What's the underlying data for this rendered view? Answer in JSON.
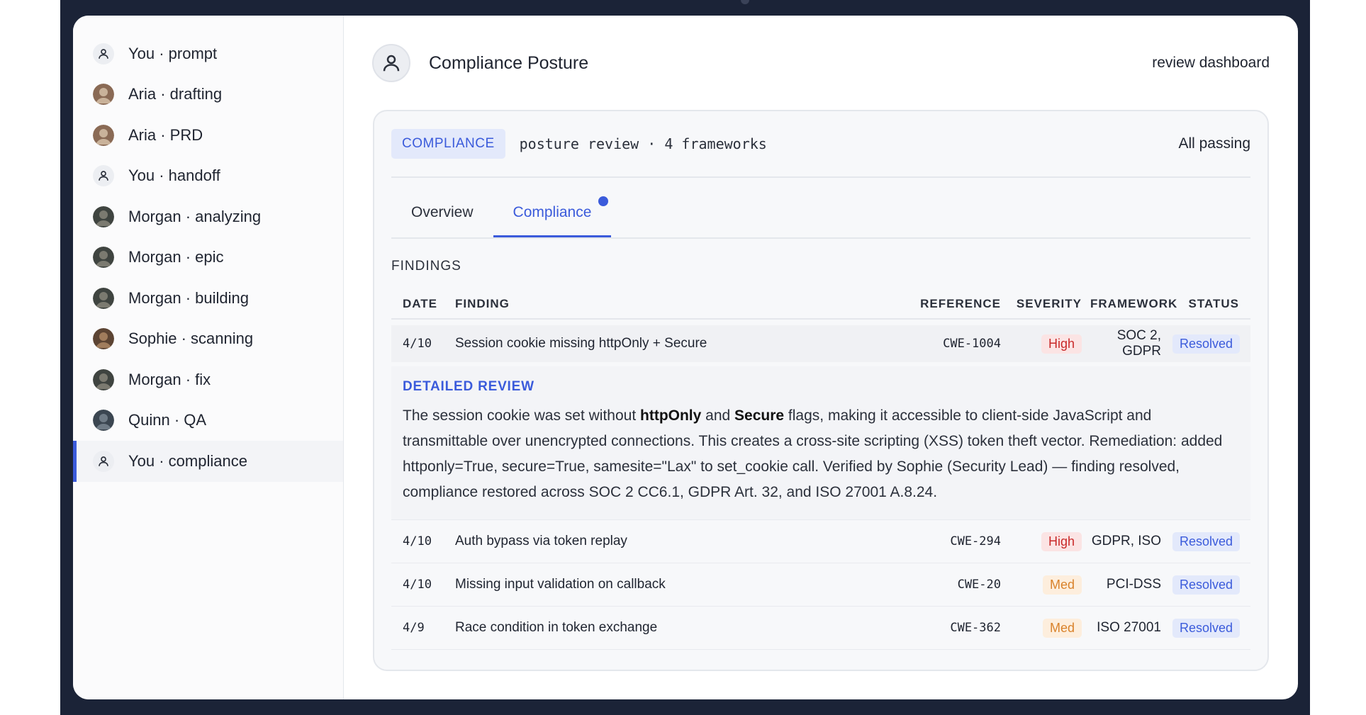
{
  "sidebar": {
    "items": [
      {
        "label": "You · prompt",
        "avatar": "user"
      },
      {
        "label": "Aria · drafting",
        "avatar": "photo-aria"
      },
      {
        "label": "Aria · PRD",
        "avatar": "photo-aria"
      },
      {
        "label": "You · handoff",
        "avatar": "user"
      },
      {
        "label": "Morgan · analyzing",
        "avatar": "photo-morgan"
      },
      {
        "label": "Morgan · epic",
        "avatar": "photo-morgan"
      },
      {
        "label": "Morgan · building",
        "avatar": "photo-morgan"
      },
      {
        "label": "Sophie · scanning",
        "avatar": "photo-sophie"
      },
      {
        "label": "Morgan · fix",
        "avatar": "photo-morgan"
      },
      {
        "label": "Quinn · QA",
        "avatar": "photo-quinn"
      },
      {
        "label": "You · compliance",
        "avatar": "user",
        "active": true
      }
    ]
  },
  "header": {
    "title": "Compliance Posture",
    "right": "review dashboard",
    "avatar_icon": "user-icon"
  },
  "card": {
    "pill": "COMPLIANCE",
    "subtitle": "posture review · 4 frameworks",
    "status": "All passing",
    "tabs": [
      {
        "label": "Overview"
      },
      {
        "label": "Compliance",
        "active": true,
        "notification": true
      }
    ],
    "section_label": "FINDINGS",
    "columns": {
      "date": "DATE",
      "finding": "FINDING",
      "reference": "REFERENCE",
      "severity": "SEVERITY",
      "framework": "FRAMEWORK",
      "status": "STATUS"
    },
    "rows": [
      {
        "date": "4/10",
        "finding": "Session cookie missing httpOnly + Secure",
        "reference": "CWE-1004",
        "severity": "High",
        "framework": "SOC 2, GDPR",
        "status": "Resolved"
      },
      {
        "date": "4/10",
        "finding": "Auth bypass via token replay",
        "reference": "CWE-294",
        "severity": "High",
        "framework": "GDPR, ISO",
        "status": "Resolved"
      },
      {
        "date": "4/10",
        "finding": "Missing input validation on callback",
        "reference": "CWE-20",
        "severity": "Med",
        "framework": "PCI-DSS",
        "status": "Resolved"
      },
      {
        "date": "4/9",
        "finding": "Race condition in token exchange",
        "reference": "CWE-362",
        "severity": "Med",
        "framework": "ISO 27001",
        "status": "Resolved"
      }
    ],
    "detail": {
      "label": "DETAILED REVIEW",
      "text_1": "The session cookie was set without ",
      "strong_1": "httpOnly",
      "text_2": " and ",
      "strong_2": "Secure",
      "text_3": " flags, making it accessible to client-side JavaScript and transmittable over unencrypted connections. This creates a cross-site scripting (XSS) token theft vector. Remediation: added httponly=True, secure=True, samesite=\"Lax\" to set_cookie call. Verified by Sophie (Security Lead) — finding resolved, compliance restored across SOC 2 CC6.1, GDPR Art. 32, and ISO 27001 A.8.24."
    }
  },
  "colors": {
    "accent": "#3b5bdb",
    "high": "#c92a2a",
    "med": "#d9822b"
  }
}
